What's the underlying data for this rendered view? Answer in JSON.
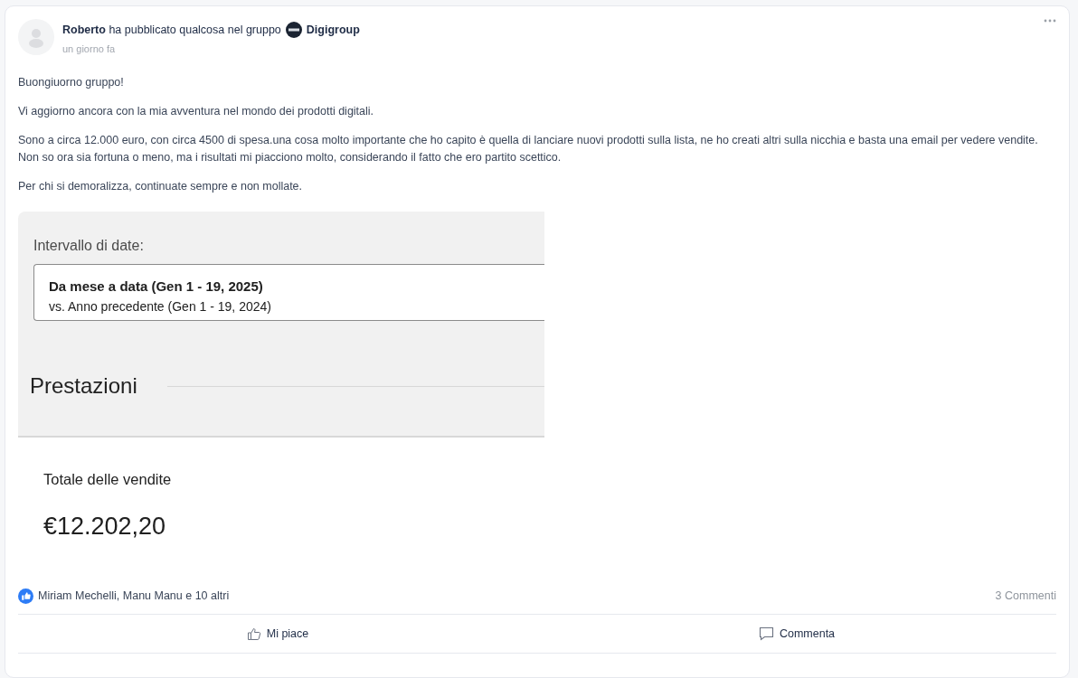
{
  "post": {
    "author_line": "**Roberto** ha pubblicato qualcosa nel gruppo",
    "group": "Digigroup",
    "time": "un giorno fa",
    "paragraphs": [
      "Buongiuorno gruppo!",
      "Vi aggiorno ancora con la mia avventura nel mondo dei prodotti digitali.",
      "Sono a circa 12.000 euro, con circa 4500 di spesa.una cosa molto importante che ho capito è quella di lanciare nuovi prodotti sulla lista, ne ho creati altri sulla nicchia e basta una email per vedere vendite. Non so ora sia fortuna o meno, ma i risultati mi piacciono molto, considerando il fatto che ero partito scettico.",
      "Per chi si demoralizza, continuate sempre e non mollate."
    ]
  },
  "attachment": {
    "date_label": "Intervallo di date:",
    "range_main": "Da mese a data (Gen 1 - 19, 2025)",
    "range_compare": "vs. Anno precedente (Gen 1 - 19, 2024)",
    "section_title": "Prestazioni",
    "metric_label": "Totale delle vendite",
    "metric_value": "€12.202,20"
  },
  "reactions": {
    "names": "Miriam Mechelli, Manu Manu e 10 altri",
    "comments": "3 Commenti"
  },
  "actions": [
    {
      "label": "Mi piace",
      "kind": "like"
    },
    {
      "label": "Commenta",
      "kind": "comment"
    }
  ]
}
